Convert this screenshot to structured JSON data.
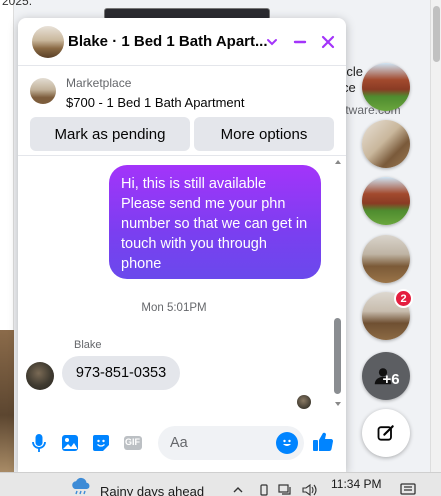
{
  "background": {
    "year_fragment": "2025.",
    "side_text_line1": "-cle",
    "side_text_line2": "ce",
    "side_domain": "ftware.com"
  },
  "chat": {
    "title": "Blake · 1 Bed 1 Bath Apart...",
    "listing": {
      "source": "Marketplace",
      "title": "$700 - 1 Bed 1 Bath Apartment"
    },
    "buttons": {
      "pending": "Mark as pending",
      "more": "More options"
    },
    "messages": {
      "sent": "Hi, this is still available Please send me your phn number so that we can get in touch with you through phone",
      "timestamp": "Mon 5:01PM",
      "sender_name": "Blake",
      "received": "973-851-0353"
    },
    "input_placeholder": "Aa",
    "gif_label": "GIF"
  },
  "bubbles": {
    "badge_count": "2",
    "more_count": "+6"
  },
  "taskbar": {
    "weather": "Rainy days ahead",
    "time": "11:34 PM"
  },
  "colors": {
    "accent": "#0084ff",
    "header_icon": "#a334fa",
    "sent_bubble_start": "#a334fa",
    "sent_bubble_end": "#6a49ec",
    "badge": "#e41e3f"
  }
}
